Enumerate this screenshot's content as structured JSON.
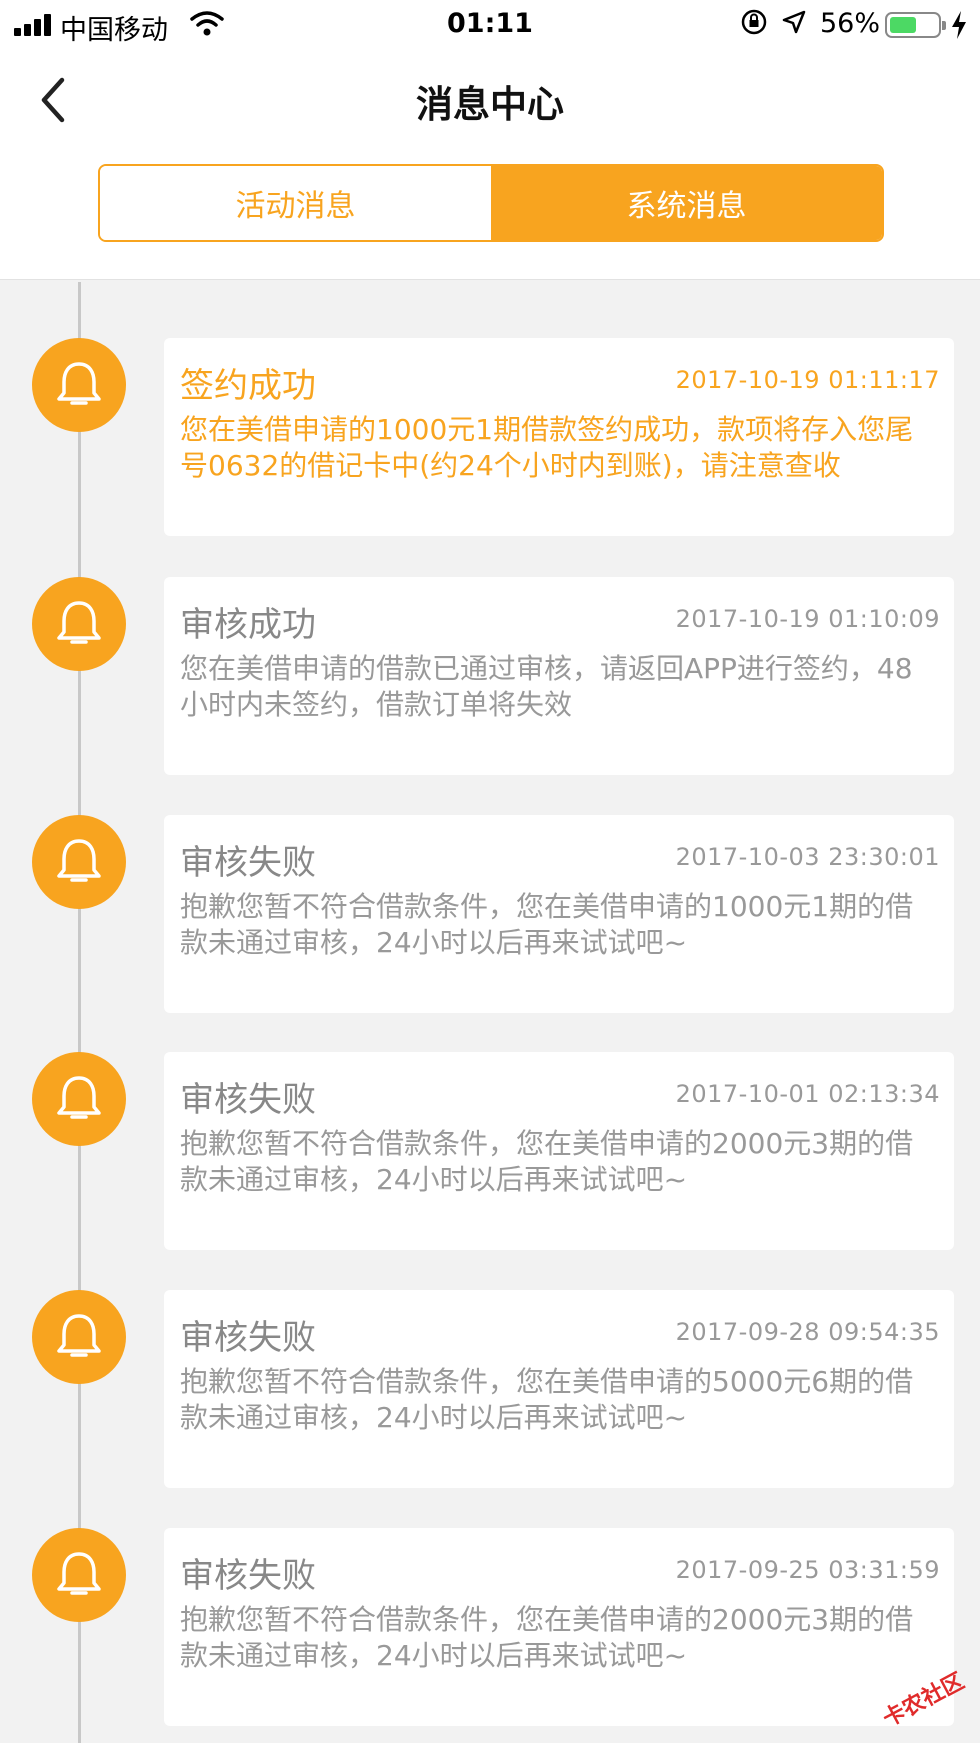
{
  "status_bar": {
    "carrier": "中国移动",
    "time": "01:11",
    "battery_percent": "56%",
    "battery_level": 0.56
  },
  "nav": {
    "title": "消息中心",
    "back_icon": "chevron-left-icon"
  },
  "tabs": [
    {
      "label": "活动消息",
      "active": false
    },
    {
      "label": "系统消息",
      "active": true
    }
  ],
  "colors": {
    "accent": "#f8a41f",
    "muted_text": "#999999"
  },
  "messages": [
    {
      "title": "签约成功",
      "time": "2017-10-19 01:11:17",
      "body": "您在美借申请的1000元1期借款签约成功，款项将存入您尾号0632的借记卡中(约24个小时内到账)，请注意查收",
      "highlighted": true
    },
    {
      "title": "审核成功",
      "time": "2017-10-19 01:10:09",
      "body": "您在美借申请的借款已通过审核，请返回APP进行签约，48小时内未签约，借款订单将失效",
      "highlighted": false
    },
    {
      "title": "审核失败",
      "time": "2017-10-03 23:30:01",
      "body": "抱歉您暂不符合借款条件，您在美借申请的1000元1期的借款未通过审核，24小时以后再来试试吧~",
      "highlighted": false
    },
    {
      "title": "审核失败",
      "time": "2017-10-01 02:13:34",
      "body": "抱歉您暂不符合借款条件，您在美借申请的2000元3期的借款未通过审核，24小时以后再来试试吧~",
      "highlighted": false
    },
    {
      "title": "审核失败",
      "time": "2017-09-28 09:54:35",
      "body": "抱歉您暂不符合借款条件，您在美借申请的5000元6期的借款未通过审核，24小时以后再来试试吧~",
      "highlighted": false
    },
    {
      "title": "审核失败",
      "time": "2017-09-25 03:31:59",
      "body": "抱歉您暂不符合借款条件，您在美借申请的2000元3期的借款未通过审核，24小时以后再来试试吧~",
      "highlighted": false
    }
  ],
  "watermark": "卡农社区"
}
